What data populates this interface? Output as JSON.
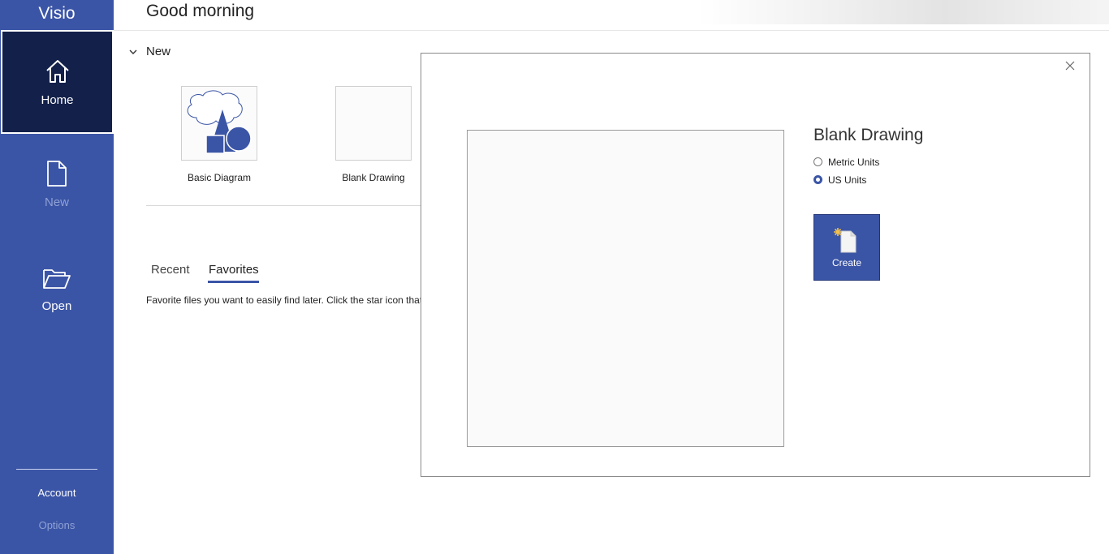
{
  "app": {
    "title": "Visio"
  },
  "nav": {
    "home": {
      "label": "Home",
      "icon": "home-icon"
    },
    "new": {
      "label": "New",
      "icon": "new-document-icon"
    },
    "open": {
      "label": "Open",
      "icon": "folder-open-icon"
    },
    "account": "Account",
    "options": "Options"
  },
  "header": {
    "greeting": "Good morning"
  },
  "new_section": {
    "heading": "New",
    "templates": [
      {
        "label": "Basic Diagram"
      },
      {
        "label": "Blank Drawing"
      }
    ]
  },
  "files": {
    "tabs": [
      {
        "label": "Recent"
      },
      {
        "label": "Favorites",
        "selected": true
      }
    ],
    "favorites_description": "Favorite files you want to easily find later. Click the star icon that"
  },
  "dialog": {
    "title": "Blank Drawing",
    "units": {
      "options": [
        "Metric Units",
        "US Units"
      ],
      "selected": "US Units"
    },
    "create_label": "Create"
  },
  "colors": {
    "sidebar": "#3b55a6",
    "sidebar_selected": "#12204a",
    "accent": "#3b55a6"
  }
}
